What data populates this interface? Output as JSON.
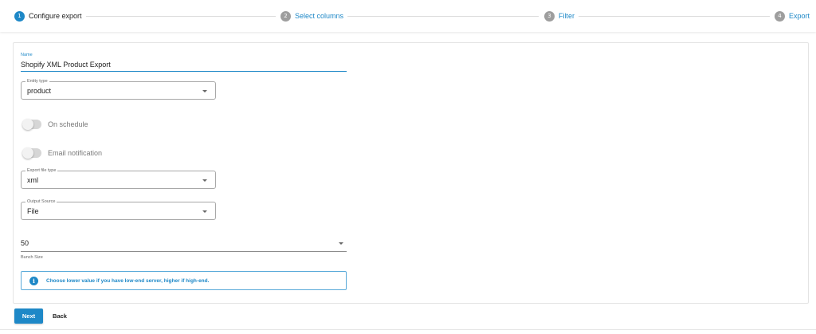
{
  "stepper": {
    "steps": [
      {
        "number": "1",
        "label": "Configure export",
        "active": true
      },
      {
        "number": "2",
        "label": "Select columns",
        "active": false
      },
      {
        "number": "3",
        "label": "Filter",
        "active": false
      },
      {
        "number": "4",
        "label": "Export",
        "active": false
      }
    ]
  },
  "form": {
    "name": {
      "label": "Name",
      "value": "Shopify XML Product Export"
    },
    "entity_type": {
      "label": "Entity type",
      "value": "product"
    },
    "on_schedule": {
      "label": "On schedule",
      "checked": false
    },
    "email_notification": {
      "label": "Email notification",
      "checked": false
    },
    "export_file_type": {
      "label": "Export file type",
      "value": "xml"
    },
    "output_source": {
      "label": "Output Source",
      "value": "File"
    },
    "bunch_size": {
      "value": "50",
      "helper": "Bunch Size"
    },
    "info": {
      "icon": "info-icon",
      "message": "Choose lower value if you have low-end server, higher if high-end."
    }
  },
  "actions": {
    "next_label": "Next",
    "back_label": "Back"
  },
  "colors": {
    "accent": "#1e88c7",
    "inactive_step": "#9e9e9e"
  }
}
